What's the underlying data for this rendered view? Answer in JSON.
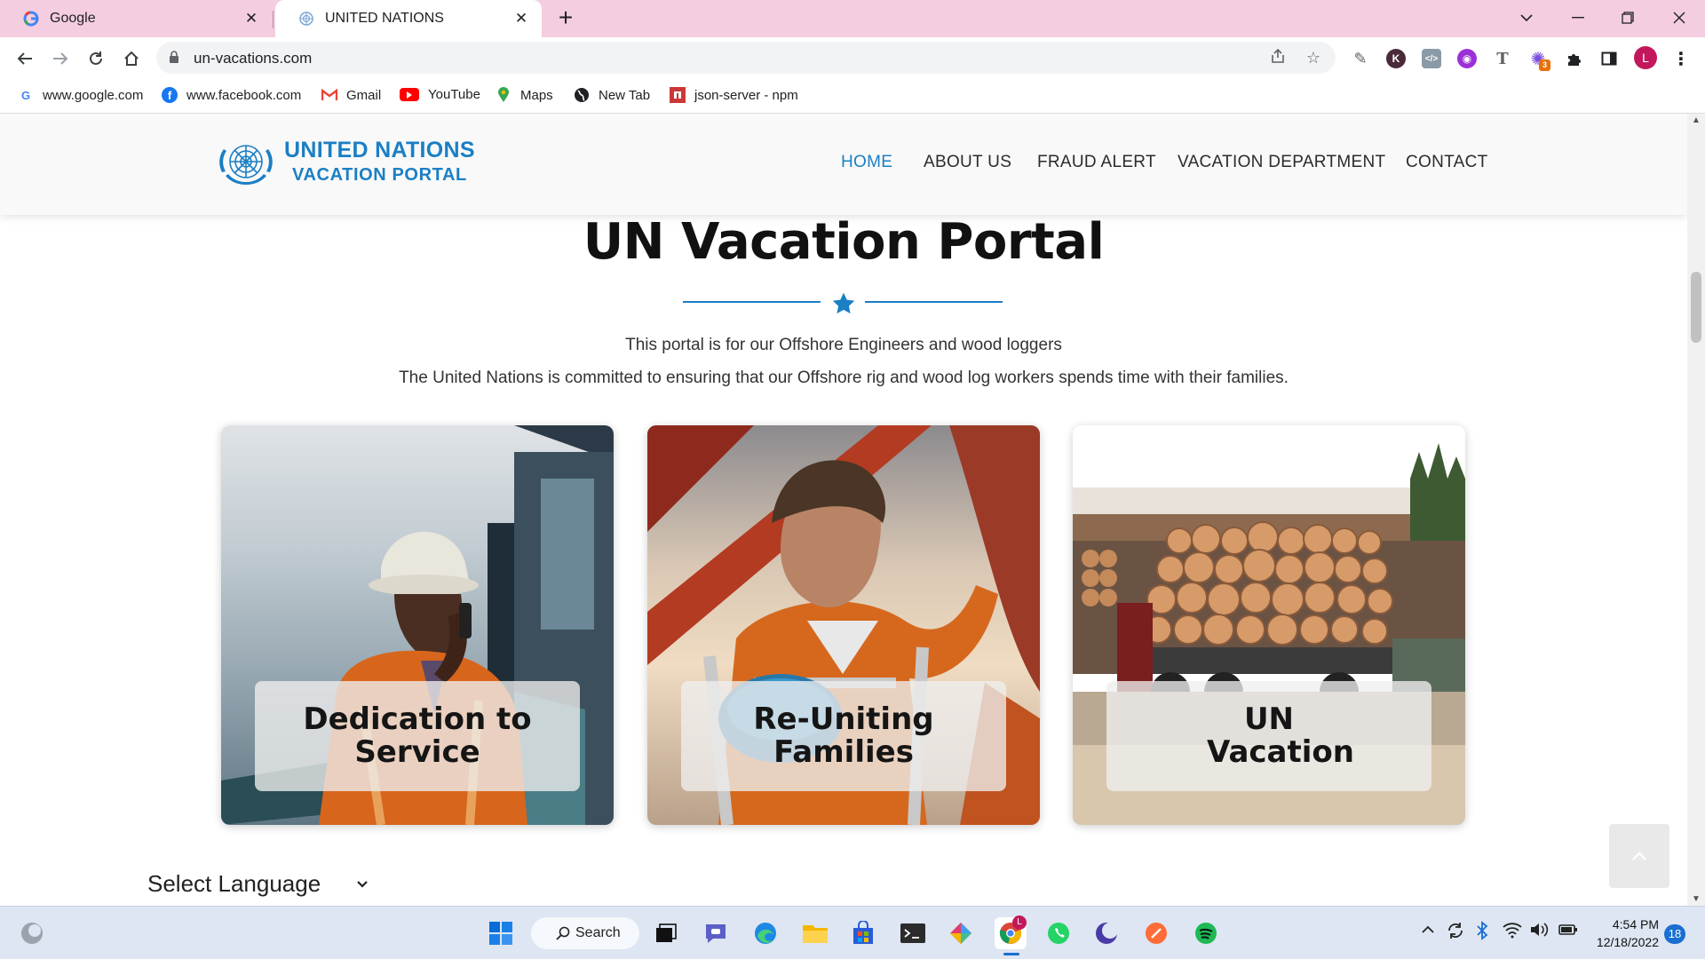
{
  "browser": {
    "tabs": [
      {
        "title": "Google",
        "favicon": "google-icon"
      },
      {
        "title": "UNITED NATIONS",
        "favicon": "un-emblem-icon",
        "active": true
      }
    ],
    "url": "un-vacations.com",
    "bookmarks": [
      {
        "label": "www.google.com",
        "icon": "google-icon"
      },
      {
        "label": "www.facebook.com",
        "icon": "facebook-icon"
      },
      {
        "label": "Gmail",
        "icon": "gmail-icon"
      },
      {
        "label": "YouTube",
        "icon": "youtube-icon"
      },
      {
        "label": "Maps",
        "icon": "maps-icon"
      },
      {
        "label": "New Tab",
        "icon": "globe-icon"
      },
      {
        "label": "json-server - npm",
        "icon": "npm-icon"
      }
    ],
    "profile_initial": "L",
    "extension_badge": "3"
  },
  "site": {
    "logo": {
      "line1": "UNITED NATIONS",
      "line2": "VACATION PORTAL"
    },
    "nav": [
      {
        "label": "HOME",
        "active": true
      },
      {
        "label": "ABOUT US"
      },
      {
        "label": "FRAUD ALERT"
      },
      {
        "label": "VACATION DEPARTMENT"
      },
      {
        "label": "CONTACT"
      }
    ],
    "hero": {
      "title": "UN Vacation Portal",
      "line1": "This portal is for our Offshore Engineers and wood loggers",
      "line2": "The United Nations is committed to ensuring that our Offshore rig and wood log workers spends time with their families."
    },
    "cards": [
      {
        "caption": "Dedication to Service",
        "image": "offshore-worker-on-phone-photo"
      },
      {
        "caption": "Re-Uniting Families",
        "image": "offshore-worker-at-sea-photo"
      },
      {
        "caption": "UN Vacation",
        "image": "logging-truck-photo"
      }
    ],
    "language_select": "Select Language",
    "accent_color": "#1b7fc4"
  },
  "taskbar": {
    "search_label": "Search",
    "time": "4:54 PM",
    "date": "12/18/2022",
    "notifications": "18",
    "chrome_badge": "L"
  }
}
